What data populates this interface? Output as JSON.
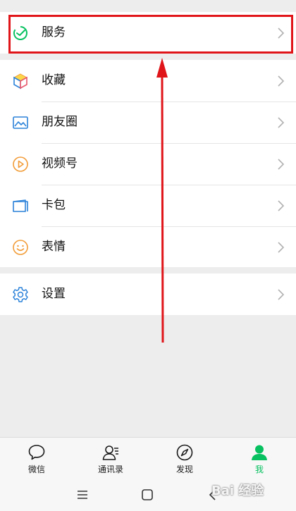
{
  "menu": {
    "services": "服务",
    "favorites": "收藏",
    "moments": "朋友圈",
    "channels": "视频号",
    "cards": "卡包",
    "stickers": "表情",
    "settings": "设置"
  },
  "tabbar": {
    "chats": "微信",
    "contacts": "通讯录",
    "discover": "发现",
    "me": "我"
  },
  "watermark": "Bai 经验",
  "colors": {
    "accent": "#07c160",
    "annotation": "#e0151a",
    "icon_blue": "#2b82d9",
    "icon_orange": "#f29c38"
  }
}
